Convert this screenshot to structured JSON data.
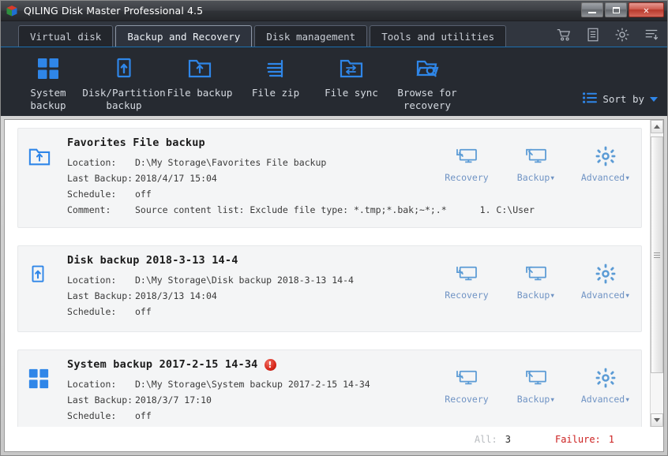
{
  "window": {
    "title": "QILING Disk Master Professional 4.5",
    "app_icon": "cube-icon",
    "controls": {
      "minimize": "minimize-icon",
      "maximize": "maximize-icon",
      "close": "✕"
    }
  },
  "tabs": [
    {
      "label": "Virtual disk",
      "active": false
    },
    {
      "label": "Backup and Recovery",
      "active": true
    },
    {
      "label": "Disk management",
      "active": false
    },
    {
      "label": "Tools and utilities",
      "active": false
    }
  ],
  "tab_tools": [
    {
      "name": "cart-icon"
    },
    {
      "name": "log-icon"
    },
    {
      "name": "gear-icon"
    },
    {
      "name": "menu-icon"
    }
  ],
  "toolbar": {
    "items": [
      {
        "label": "System backup",
        "icon": "grid-icon"
      },
      {
        "label": "Disk/Partition\nbackup",
        "icon": "disk-arrow-icon"
      },
      {
        "label": "File backup",
        "icon": "folder-arrow-icon"
      },
      {
        "label": "File zip",
        "icon": "zip-icon"
      },
      {
        "label": "File sync",
        "icon": "folder-sync-icon"
      },
      {
        "label": "Browse for\nrecovery",
        "icon": "folder-search-icon"
      }
    ],
    "sort_by": "Sort by",
    "sort_icon": "list-icon"
  },
  "labels": {
    "location": "Location:",
    "last_backup": "Last Backup:",
    "schedule": "Schedule:",
    "comment": "Comment:"
  },
  "actions": {
    "recovery": "Recovery",
    "backup": "Backup▾",
    "advanced": "Advanced▾"
  },
  "cards": [
    {
      "title": "Favorites File backup",
      "icon": "folder-arrow-icon",
      "has_error": false,
      "location": "D:\\My Storage\\Favorites File backup",
      "last_backup": "2018/4/17 15:04",
      "schedule": "off",
      "comment_main": "Source content list:  Exclude file type: *.tmp;*.bak;~*;.*",
      "comment_extra": "1. C:\\User"
    },
    {
      "title": "Disk backup 2018-3-13 14-4",
      "icon": "disk-arrow-icon",
      "has_error": false,
      "location": "D:\\My Storage\\Disk backup 2018-3-13 14-4",
      "last_backup": "2018/3/13 14:04",
      "schedule": "off",
      "comment_main": "",
      "comment_extra": ""
    },
    {
      "title": "System backup 2017-2-15 14-34",
      "icon": "grid-icon",
      "has_error": true,
      "error_glyph": "!",
      "location": "D:\\My Storage\\System backup 2017-2-15 14-34",
      "last_backup": "2018/3/7 17:10",
      "schedule": "off",
      "comment_main": "",
      "comment_extra": ""
    }
  ],
  "statusbar": {
    "all_label": "All:",
    "all_value": "3",
    "failure_label": "Failure:",
    "failure_value": "1"
  },
  "colors": {
    "accent_blue": "#2f86e8",
    "title_dark": "#31363f",
    "toolbar_dark": "#262a31",
    "error_red": "#cc2020",
    "action_blue": "#6f93c4"
  }
}
